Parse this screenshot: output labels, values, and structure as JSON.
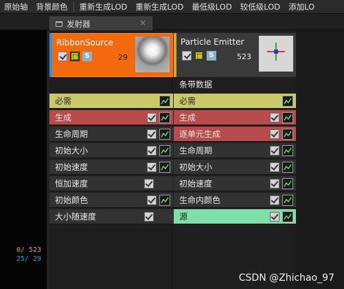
{
  "toolbar": [
    "原始轴",
    "背景颜色",
    "重新生成LOD",
    "重新生成LOD",
    "最低级LOD",
    "较低级LOD",
    "添加LO"
  ],
  "tab": {
    "title": "发射器",
    "close": "×"
  },
  "viewport": {
    "stat1": "0/ 523",
    "stat2": "25/ 29"
  },
  "emitters": [
    {
      "name": "RibbonSource",
      "count": "29",
      "s_label": "S",
      "rows": [
        {
          "label": "必需",
          "type": "yellow",
          "check": false,
          "graph": true
        },
        {
          "label": "生成",
          "type": "red",
          "check": true,
          "graph": true
        },
        {
          "label": "生命周期",
          "type": "dark",
          "check": true,
          "graph": true
        },
        {
          "label": "初始大小",
          "type": "dark",
          "check": true,
          "graph": true
        },
        {
          "label": "初始速度",
          "type": "dark",
          "check": true,
          "graph": true
        },
        {
          "label": "恒加速度",
          "type": "dark",
          "check": true,
          "graph": false
        },
        {
          "label": "初始颜色",
          "type": "dark",
          "check": true,
          "graph": true
        },
        {
          "label": "大小随速度",
          "type": "dark",
          "check": true,
          "graph": false
        }
      ]
    },
    {
      "name": "Particle Emitter",
      "count": "523",
      "s_label": "S",
      "section_title": "条带数据",
      "rows": [
        {
          "label": "必需",
          "type": "yellow",
          "check": false,
          "graph": true
        },
        {
          "label": "生成",
          "type": "red",
          "check": true,
          "graph": true
        },
        {
          "label": "逐单元生成",
          "type": "red",
          "check": true,
          "graph": true
        },
        {
          "label": "生命周期",
          "type": "dark",
          "check": true,
          "graph": true
        },
        {
          "label": "初始大小",
          "type": "dark",
          "check": true,
          "graph": true
        },
        {
          "label": "初始速度",
          "type": "dark",
          "check": true,
          "graph": true
        },
        {
          "label": "生命内颜色",
          "type": "dark",
          "check": true,
          "graph": true
        },
        {
          "label": "源",
          "type": "green",
          "check": true,
          "graph": true
        }
      ]
    }
  ],
  "watermark": "CSDN @Zhichao_97"
}
